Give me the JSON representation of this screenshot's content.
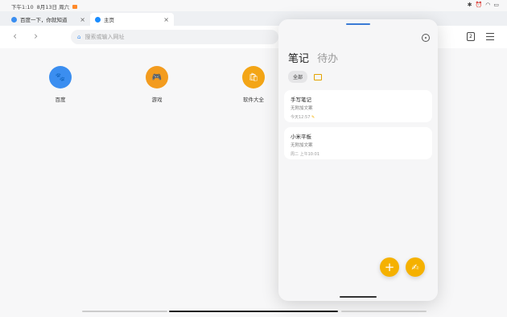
{
  "statusbar": {
    "time": "下午1:10",
    "date": "8月13日 周六"
  },
  "tabs": [
    {
      "label": "百度一下，你就知道",
      "close": "×"
    },
    {
      "label": "主页",
      "close": "×"
    }
  ],
  "newtab": "+",
  "address": {
    "placeholder": "搜索或输入网址"
  },
  "nav": {
    "back": "‹",
    "forward": "›"
  },
  "tab_count": "2",
  "shortcuts": [
    {
      "label": "百度",
      "color": "#3b8ef0"
    },
    {
      "label": "游戏",
      "color": "#f39c1f"
    },
    {
      "label": "软件大全",
      "color": "#f3a516"
    }
  ],
  "notes": {
    "tab_notes": "笔记",
    "tab_todo": "待办",
    "chip_all": "全部",
    "items": [
      {
        "title": "手写笔记",
        "subtitle": "无附加文案",
        "date": "今天12:57"
      },
      {
        "title": "小米平板",
        "subtitle": "无附加文案",
        "date": "周二 上午10:01"
      }
    ],
    "fab_add": "+",
    "accent_color": "#f5b100"
  }
}
